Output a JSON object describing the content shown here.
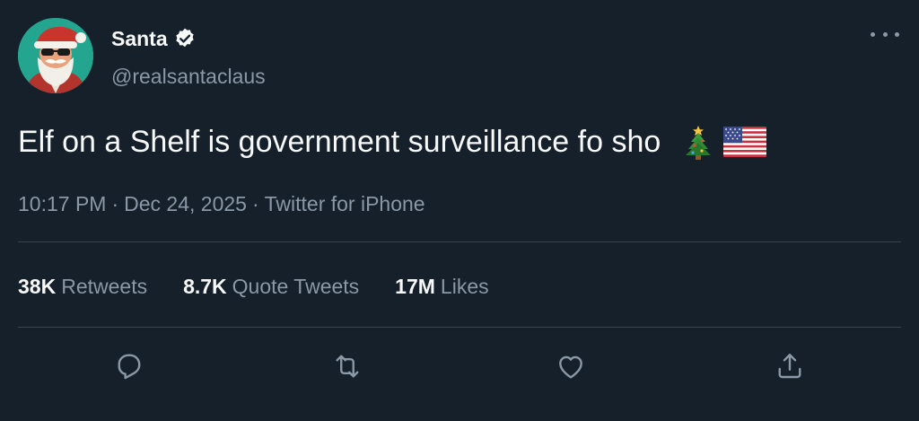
{
  "tweet": {
    "display_name": "Santa",
    "handle": "@realsantaclaus",
    "text": "Elf on a Shelf is government surveillance fo sho",
    "emojis": [
      "christmas-tree-emoji",
      "us-flag-emoji"
    ],
    "time": "10:17 PM",
    "date": "Dec 24, 2025",
    "separator": "·",
    "source": "Twitter for iPhone"
  },
  "stats": [
    {
      "count": "38K",
      "label": "Retweets"
    },
    {
      "count": "8.7K",
      "label": "Quote Tweets"
    },
    {
      "count": "17M",
      "label": "Likes"
    }
  ],
  "actions": [
    "reply-icon",
    "retweet-icon",
    "like-icon",
    "share-icon"
  ],
  "colors": {
    "background": "#15202b",
    "text_primary": "#f7f9f9",
    "text_secondary": "#8b98a5",
    "divider": "#38444d"
  }
}
